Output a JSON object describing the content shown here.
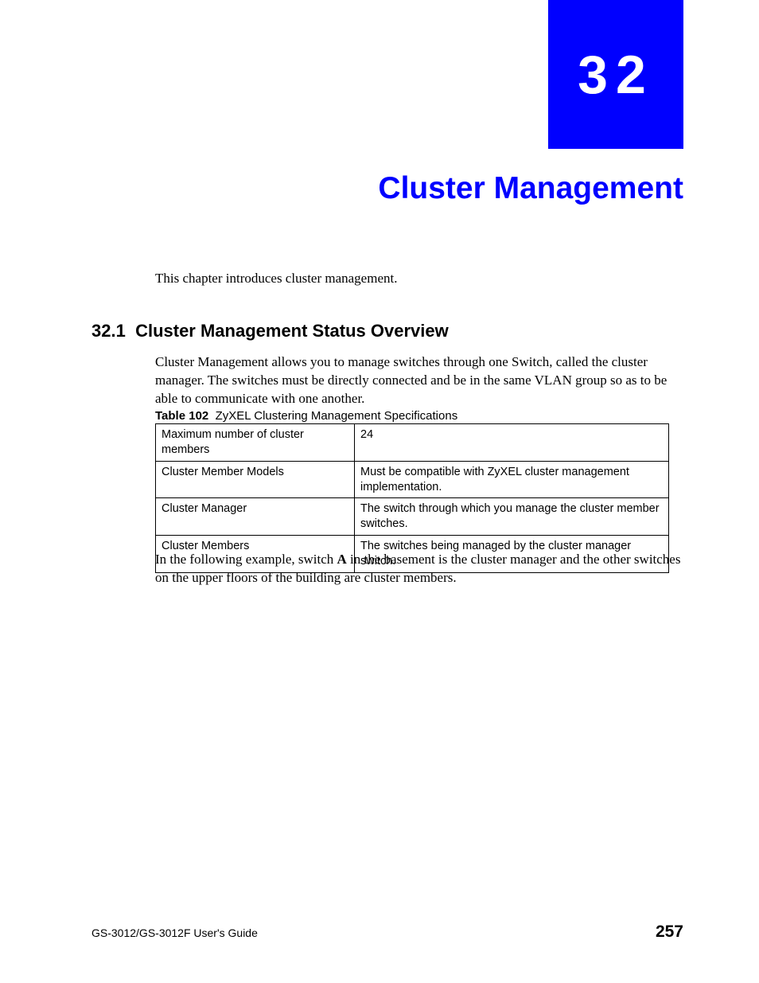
{
  "chapter": {
    "number": "32",
    "title": "Cluster Management"
  },
  "intro": "This chapter introduces cluster management.",
  "section": {
    "number": "32.1",
    "title": "Cluster Management Status Overview",
    "para1": "Cluster Management allows you to manage switches through one Switch, called the cluster manager. The switches must be directly connected and be in the same VLAN group so as to be able to communicate with one another.",
    "table_caption_label": "Table 102",
    "table_caption_text": "ZyXEL Clustering Management Specifications",
    "table_rows": [
      {
        "label": "Maximum number of cluster members",
        "value": "24"
      },
      {
        "label": "Cluster Member Models",
        "value": "Must be compatible with ZyXEL cluster management implementation."
      },
      {
        "label": "Cluster Manager",
        "value": "The switch through which you manage the cluster member switches."
      },
      {
        "label": "Cluster Members",
        "value": "The switches being managed by the cluster manager switch."
      }
    ],
    "para2_pre": "In the following example, switch ",
    "para2_bold": "A",
    "para2_post": " in the basement is the cluster manager and the other switches on the upper floors of the building are cluster members."
  },
  "footer": {
    "left": "GS-3012/GS-3012F User's Guide",
    "right": "257"
  }
}
